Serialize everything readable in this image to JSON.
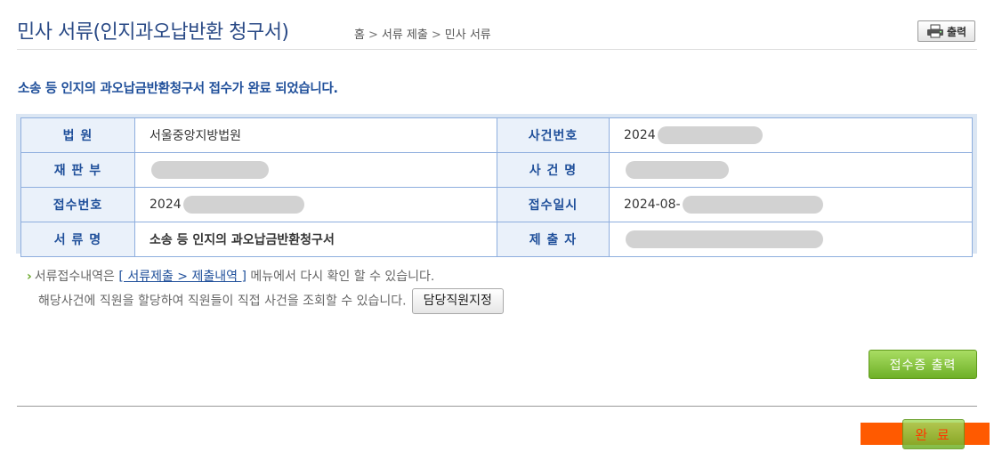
{
  "header": {
    "title": "민사 서류(인지과오납반환 청구서)",
    "breadcrumb": [
      "홈",
      "서류 제출",
      "민사 서류"
    ],
    "breadcrumb_separator": ">",
    "print_label": "출력"
  },
  "message": "소송 등 인지의 과오납금반환청구서 접수가 완료 되었습니다.",
  "info": {
    "court_label": "법 원",
    "court_value": "서울중앙지방법원",
    "case_no_label": "사건번호",
    "case_no_value": "2024",
    "division_label": "재 판 부",
    "division_value": "",
    "case_name_label": "사 건 명",
    "case_name_value": "",
    "receipt_no_label": "접수번호",
    "receipt_no_value": "2024",
    "receipt_date_label": "접수일시",
    "receipt_date_value": "2024-08-",
    "doc_name_label": "서 류 명",
    "doc_name_value": "소송 등 인지의 과오납금반환청구서",
    "submitter_label": "제 출 자",
    "submitter_value": ""
  },
  "note": {
    "line1_pre": "서류접수내역은",
    "line1_link": "[ 서류제출 > 제출내역 ]",
    "line1_post": "메뉴에서 다시 확인 할 수 있습니다.",
    "line2": "해당사건에 직원을 할당하여 직원들이 직접 사건을 조회할 수 있습니다.",
    "assign_button": "담당직원지정"
  },
  "buttons": {
    "receipt_print": "접수증 출력",
    "complete": "완 료"
  },
  "colors": {
    "title": "#2a4a86",
    "accent_green": "#6eb027",
    "highlight_orange": "#ff5a00"
  }
}
